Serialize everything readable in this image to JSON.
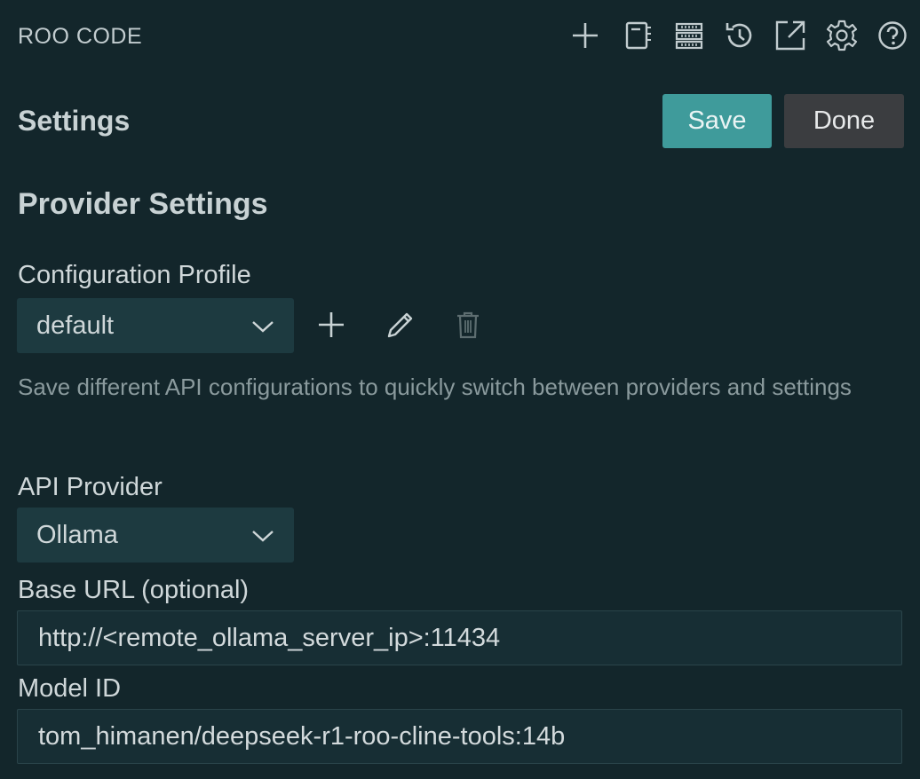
{
  "header": {
    "app_title": "ROO CODE",
    "icons": [
      "plus-icon",
      "notebook-icon",
      "server-icon",
      "history-icon",
      "external-link-icon",
      "gear-icon",
      "help-icon"
    ]
  },
  "page": {
    "title": "Settings",
    "save_label": "Save",
    "done_label": "Done"
  },
  "provider_settings": {
    "section_title": "Provider Settings",
    "config_profile": {
      "label": "Configuration Profile",
      "selected": "default",
      "description": "Save different API configurations to quickly switch between providers and settings"
    },
    "api_provider": {
      "label": "API Provider",
      "selected": "Ollama"
    },
    "base_url": {
      "label": "Base URL (optional)",
      "value": "http://<remote_ollama_server_ip>:11434"
    },
    "model_id": {
      "label": "Model ID",
      "value": "tom_himanen/deepseek-r1-roo-cline-tools:14b"
    }
  },
  "colors": {
    "background": "#13262b",
    "accent": "#3f9b9b",
    "secondary_button": "#3b3d40",
    "select_bg": "#1d3a40"
  }
}
